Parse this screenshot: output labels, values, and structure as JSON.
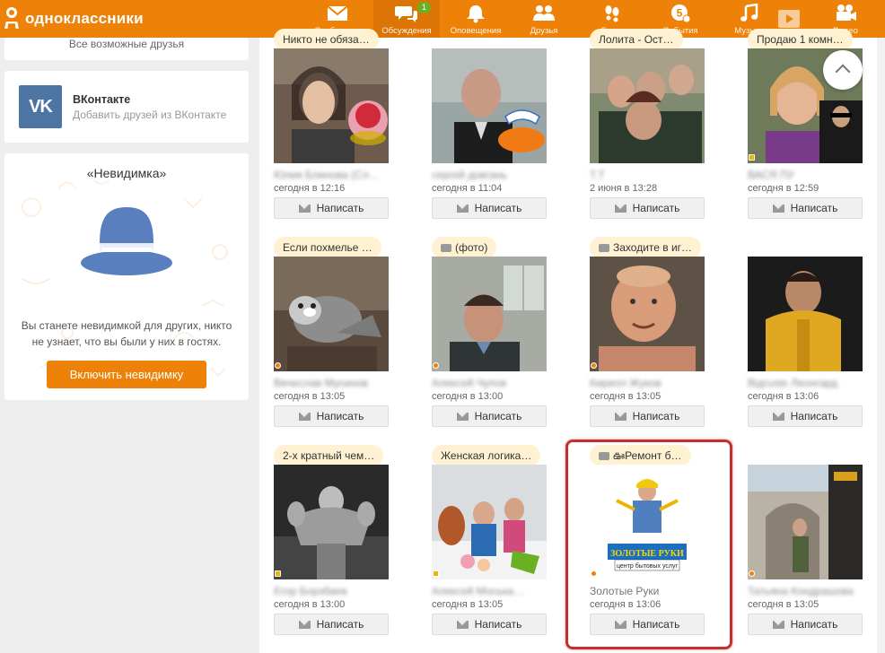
{
  "logo": {
    "text": "одноклассники"
  },
  "nav": [
    {
      "label": "Сообщения",
      "icon": "envelope-icon"
    },
    {
      "label": "Обсуждения",
      "icon": "chat-bubbles-icon",
      "badge": "1",
      "active": true
    },
    {
      "label": "Оповещения",
      "icon": "bell-icon"
    },
    {
      "label": "Друзья",
      "icon": "friends-icon"
    },
    {
      "label": "Гости",
      "icon": "footprints-icon"
    },
    {
      "label": "События",
      "icon": "events-icon"
    },
    {
      "label": "Музыка",
      "icon": "music-note-icon"
    },
    {
      "label": "Видео",
      "icon": "video-camera-icon"
    }
  ],
  "left": {
    "friends_text": "Все возможные друзья",
    "vk": {
      "title": "ВКонтакте",
      "subtitle": "Добавить друзей из ВКонтакте",
      "logo_text": "VK"
    },
    "invisible": {
      "title": "«Невидимка»",
      "text1": "Вы станете невидимкой для других, никто",
      "text2": "не узнает, что вы были у них в гостях.",
      "button": "Включить невидимку"
    }
  },
  "colors": {
    "brand": "#ee8208",
    "highlight": "#c42f2f",
    "vk": "#4c75a3"
  },
  "guests": [
    {
      "status": "Никто не обяза…",
      "name": "Юлия Блинова (Сл…",
      "time": "сегодня в 12:16",
      "button": "Написать"
    },
    {
      "status": "",
      "name": "сергей довгань",
      "time": "сегодня в 11:04",
      "button": "Написать"
    },
    {
      "status": "Лолита - Ост…",
      "name": "Т.Т",
      "time": "2 июня в 13:28",
      "button": "Написать"
    },
    {
      "status": "Продаю 1 комн…",
      "name": "ВАСЯ ПУ",
      "time": "сегодня в 12:59",
      "button": "Написать"
    },
    {
      "status": "Если похмелье …",
      "name": "Вячеслав Мусинов",
      "time": "сегодня в 13:05",
      "button": "Написать"
    },
    {
      "status": "(фото)",
      "name": "Алексей Чупов",
      "time": "сегодня в 13:00",
      "button": "Написать"
    },
    {
      "status": "Заходите в иг…",
      "name": "Кирилл Жуков",
      "time": "сегодня в 13:05",
      "button": "Написать"
    },
    {
      "status": "",
      "name": "Відгuste Леонгард",
      "time": "сегодня в 13:06",
      "button": "Написать"
    },
    {
      "status": "2-х кратный чем…",
      "name": "Егор Борзбаев",
      "time": "сегодня в 13:00",
      "button": "Написать"
    },
    {
      "status": "Женская логика…",
      "name": "Алексей Моська…",
      "time": "сегодня в 13:05",
      "button": "Написать"
    },
    {
      "status": "ఊРемонт б…",
      "name": "Золотые Руки",
      "time": "сегодня в 13:06",
      "button": "Написать",
      "photo_text1": "ЗОЛОТЫЕ РУКИ",
      "photo_text2": "центр бытовых услуг"
    },
    {
      "status": "",
      "name": "Татьяна Кондрашова",
      "time": "сегодня в 13:05",
      "button": "Написать"
    }
  ]
}
